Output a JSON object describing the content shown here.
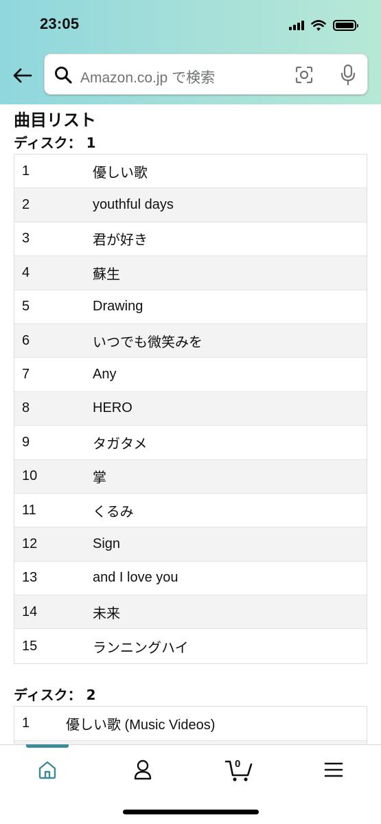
{
  "status_bar": {
    "time": "23:05"
  },
  "search": {
    "placeholder": "Amazon.co.jp で検索"
  },
  "section_title": "曲目リスト",
  "discs": [
    {
      "label": "ディスク： 1",
      "tracks": [
        {
          "num": "1",
          "title": "優しい歌"
        },
        {
          "num": "2",
          "title": "youthful days"
        },
        {
          "num": "3",
          "title": "君が好き"
        },
        {
          "num": "4",
          "title": "蘇生"
        },
        {
          "num": "5",
          "title": "Drawing"
        },
        {
          "num": "6",
          "title": "いつでも微笑みを"
        },
        {
          "num": "7",
          "title": "Any"
        },
        {
          "num": "8",
          "title": "HERO"
        },
        {
          "num": "9",
          "title": "タガタメ"
        },
        {
          "num": "10",
          "title": "掌"
        },
        {
          "num": "11",
          "title": "くるみ"
        },
        {
          "num": "12",
          "title": "Sign"
        },
        {
          "num": "13",
          "title": "and I love you"
        },
        {
          "num": "14",
          "title": "未来"
        },
        {
          "num": "15",
          "title": "ランニングハイ"
        }
      ]
    },
    {
      "label": "ディスク： 2",
      "tracks": [
        {
          "num": "1",
          "title": "優しい歌 (Music Videos)"
        }
      ]
    }
  ],
  "bottom_nav": {
    "cart_count": "0",
    "items": [
      "home-icon",
      "account-icon",
      "cart-icon",
      "menu-icon"
    ]
  },
  "colors": {
    "header_accent": "#a5dfd9",
    "nav_active": "#3b8a9a"
  }
}
